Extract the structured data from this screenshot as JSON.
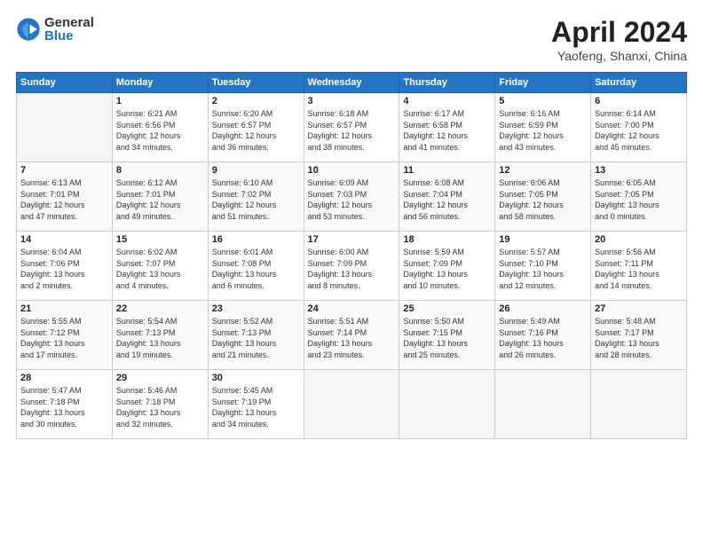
{
  "logo": {
    "general": "General",
    "blue": "Blue"
  },
  "title": "April 2024",
  "subtitle": "Yaofeng, Shanxi, China",
  "days_of_week": [
    "Sunday",
    "Monday",
    "Tuesday",
    "Wednesday",
    "Thursday",
    "Friday",
    "Saturday"
  ],
  "weeks": [
    [
      {
        "day": "",
        "info": ""
      },
      {
        "day": "1",
        "info": "Sunrise: 6:21 AM\nSunset: 6:56 PM\nDaylight: 12 hours\nand 34 minutes."
      },
      {
        "day": "2",
        "info": "Sunrise: 6:20 AM\nSunset: 6:57 PM\nDaylight: 12 hours\nand 36 minutes."
      },
      {
        "day": "3",
        "info": "Sunrise: 6:18 AM\nSunset: 6:57 PM\nDaylight: 12 hours\nand 38 minutes."
      },
      {
        "day": "4",
        "info": "Sunrise: 6:17 AM\nSunset: 6:58 PM\nDaylight: 12 hours\nand 41 minutes."
      },
      {
        "day": "5",
        "info": "Sunrise: 6:16 AM\nSunset: 6:59 PM\nDaylight: 12 hours\nand 43 minutes."
      },
      {
        "day": "6",
        "info": "Sunrise: 6:14 AM\nSunset: 7:00 PM\nDaylight: 12 hours\nand 45 minutes."
      }
    ],
    [
      {
        "day": "7",
        "info": "Sunrise: 6:13 AM\nSunset: 7:01 PM\nDaylight: 12 hours\nand 47 minutes."
      },
      {
        "day": "8",
        "info": "Sunrise: 6:12 AM\nSunset: 7:01 PM\nDaylight: 12 hours\nand 49 minutes."
      },
      {
        "day": "9",
        "info": "Sunrise: 6:10 AM\nSunset: 7:02 PM\nDaylight: 12 hours\nand 51 minutes."
      },
      {
        "day": "10",
        "info": "Sunrise: 6:09 AM\nSunset: 7:03 PM\nDaylight: 12 hours\nand 53 minutes."
      },
      {
        "day": "11",
        "info": "Sunrise: 6:08 AM\nSunset: 7:04 PM\nDaylight: 12 hours\nand 56 minutes."
      },
      {
        "day": "12",
        "info": "Sunrise: 6:06 AM\nSunset: 7:05 PM\nDaylight: 12 hours\nand 58 minutes."
      },
      {
        "day": "13",
        "info": "Sunrise: 6:05 AM\nSunset: 7:05 PM\nDaylight: 13 hours\nand 0 minutes."
      }
    ],
    [
      {
        "day": "14",
        "info": "Sunrise: 6:04 AM\nSunset: 7:06 PM\nDaylight: 13 hours\nand 2 minutes."
      },
      {
        "day": "15",
        "info": "Sunrise: 6:02 AM\nSunset: 7:07 PM\nDaylight: 13 hours\nand 4 minutes."
      },
      {
        "day": "16",
        "info": "Sunrise: 6:01 AM\nSunset: 7:08 PM\nDaylight: 13 hours\nand 6 minutes."
      },
      {
        "day": "17",
        "info": "Sunrise: 6:00 AM\nSunset: 7:09 PM\nDaylight: 13 hours\nand 8 minutes."
      },
      {
        "day": "18",
        "info": "Sunrise: 5:59 AM\nSunset: 7:09 PM\nDaylight: 13 hours\nand 10 minutes."
      },
      {
        "day": "19",
        "info": "Sunrise: 5:57 AM\nSunset: 7:10 PM\nDaylight: 13 hours\nand 12 minutes."
      },
      {
        "day": "20",
        "info": "Sunrise: 5:56 AM\nSunset: 7:11 PM\nDaylight: 13 hours\nand 14 minutes."
      }
    ],
    [
      {
        "day": "21",
        "info": "Sunrise: 5:55 AM\nSunset: 7:12 PM\nDaylight: 13 hours\nand 17 minutes."
      },
      {
        "day": "22",
        "info": "Sunrise: 5:54 AM\nSunset: 7:13 PM\nDaylight: 13 hours\nand 19 minutes."
      },
      {
        "day": "23",
        "info": "Sunrise: 5:52 AM\nSunset: 7:13 PM\nDaylight: 13 hours\nand 21 minutes."
      },
      {
        "day": "24",
        "info": "Sunrise: 5:51 AM\nSunset: 7:14 PM\nDaylight: 13 hours\nand 23 minutes."
      },
      {
        "day": "25",
        "info": "Sunrise: 5:50 AM\nSunset: 7:15 PM\nDaylight: 13 hours\nand 25 minutes."
      },
      {
        "day": "26",
        "info": "Sunrise: 5:49 AM\nSunset: 7:16 PM\nDaylight: 13 hours\nand 26 minutes."
      },
      {
        "day": "27",
        "info": "Sunrise: 5:48 AM\nSunset: 7:17 PM\nDaylight: 13 hours\nand 28 minutes."
      }
    ],
    [
      {
        "day": "28",
        "info": "Sunrise: 5:47 AM\nSunset: 7:18 PM\nDaylight: 13 hours\nand 30 minutes."
      },
      {
        "day": "29",
        "info": "Sunrise: 5:46 AM\nSunset: 7:18 PM\nDaylight: 13 hours\nand 32 minutes."
      },
      {
        "day": "30",
        "info": "Sunrise: 5:45 AM\nSunset: 7:19 PM\nDaylight: 13 hours\nand 34 minutes."
      },
      {
        "day": "",
        "info": ""
      },
      {
        "day": "",
        "info": ""
      },
      {
        "day": "",
        "info": ""
      },
      {
        "day": "",
        "info": ""
      }
    ]
  ]
}
